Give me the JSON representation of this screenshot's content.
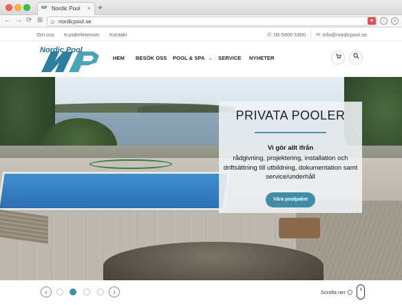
{
  "browser": {
    "tab_title": "Nordic Pool",
    "tab_favicon": "NP",
    "tab_close": "×",
    "new_tab": "+",
    "url": "nordicpool.se",
    "back_icon": "←",
    "forward_icon": "→",
    "reload_icon": "⟳",
    "apps_icon": "⊞"
  },
  "topbar": {
    "links": [
      "Om oss",
      "Kundreferenser",
      "Kontakt"
    ],
    "phone": "08-5600 5300",
    "email": "info@nordicpool.se"
  },
  "header": {
    "logo_text": "Nordic Pool",
    "logo_mark": "NP",
    "menu": [
      "HEM",
      "BESÖK OSS",
      "POOL & SPA",
      "SERVICE",
      "NYHETER"
    ],
    "dropdown_indicator": "⌄",
    "cart_icon": "cart-icon",
    "search_icon": "search-icon"
  },
  "hero": {
    "title": "PRIVATA POOLER",
    "lead": "Vi gör allt ifrån",
    "body": "rådgivning, projektering, installation och driftsättning till utbildning, dokumentation samt service/underhåll",
    "button": "Våra poolpaket"
  },
  "slider": {
    "prev": "‹",
    "next": "›",
    "dot_count": 5,
    "active_index": 1,
    "scroll_label": "Scrolla ner"
  },
  "colors": {
    "accent": "#3f8da6",
    "brand": "#1f6a8f"
  }
}
